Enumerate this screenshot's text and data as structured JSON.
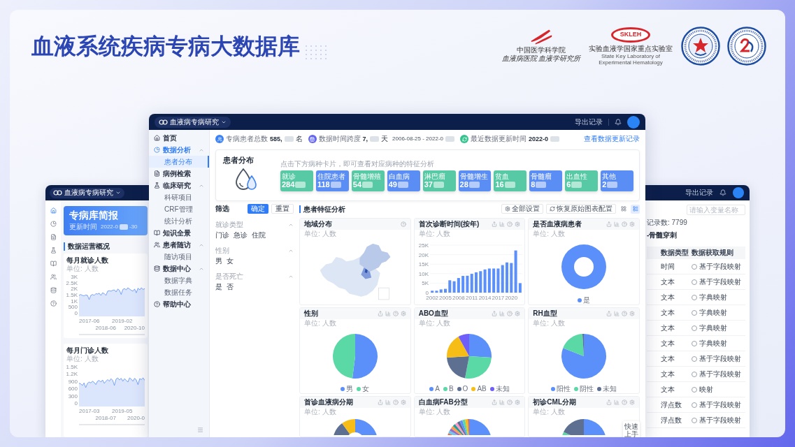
{
  "slide": {
    "title": "血液系统疾病专病大数据库"
  },
  "logos": {
    "institute_line_1": "中国医学科学院",
    "institute_line_2": "血液病医院 血液学研究所",
    "lab_badge": "SKLEH",
    "lab_name": "实验血液学国家重点实验室",
    "lab_name_en": "State Key Laboratory of Experimental Hematology"
  },
  "left_window": {
    "project": "血液病专病研究",
    "rail": [
      {
        "selected": true
      },
      {
        "selected": false
      },
      {
        "selected": false
      },
      {
        "selected": false
      },
      {
        "selected": false
      },
      {
        "selected": false
      },
      {
        "selected": false
      },
      {
        "selected": false
      }
    ],
    "banner": {
      "title": "专病库简报",
      "date_label": "更新时间",
      "date": "2022-0",
      "date_masked": true,
      "date_end": "-30"
    },
    "section_title": "数据运营概况",
    "charts": [
      {
        "title": "每月就诊人数",
        "unit": "单位: 人数",
        "y_labels": [
          "3K",
          "2.5K",
          "2K",
          "1.5K",
          "1K",
          "500",
          "0"
        ],
        "x_labels": [
          "2017-06",
          "2018-06",
          "2019-02",
          "2020-10"
        ]
      },
      {
        "title": "每月门诊人数",
        "unit": "单位: 人数",
        "y_labels": [
          "1.5K",
          "1.2K",
          "900",
          "600",
          "300",
          "0"
        ],
        "x_labels": [
          "2017-03",
          "2018-07",
          "2019-05",
          "2020-0"
        ]
      }
    ]
  },
  "main_window": {
    "project": "血液病专病研究",
    "header_link": "导出记录",
    "sidebar": [
      {
        "label": "首页",
        "selected": false
      },
      {
        "label": "数据分析",
        "selected": true,
        "expanded": true,
        "children": [
          {
            "label": "患者分布",
            "selected": true
          }
        ]
      },
      {
        "label": "病例检索",
        "selected": false
      },
      {
        "label": "临床研究",
        "selected": false,
        "expanded": true,
        "children": [
          {
            "label": "科研项目",
            "selected": false
          },
          {
            "label": "CRF管理",
            "selected": false
          },
          {
            "label": "统计分析",
            "selected": false
          }
        ]
      },
      {
        "label": "知识全景",
        "selected": false
      },
      {
        "label": "患者随访",
        "selected": false,
        "expanded": true,
        "children": [
          {
            "label": "随访项目",
            "selected": false
          }
        ]
      },
      {
        "label": "数据中心",
        "selected": false,
        "expanded": true,
        "children": [
          {
            "label": "数据字典",
            "selected": false
          },
          {
            "label": "数据任务",
            "selected": false
          }
        ]
      },
      {
        "label": "帮助中心",
        "selected": false
      }
    ],
    "stats": [
      {
        "label": "专病患者总数",
        "value": "585,",
        "masked": true,
        "unit": "名",
        "color": "#3b82f6"
      },
      {
        "label": "数据时间跨度",
        "value": "7,",
        "masked": true,
        "unit": "天",
        "range": "2006-08-25 - 2022-0",
        "range_masked": true,
        "color": "#6366f1"
      },
      {
        "label": "最近数据更新时间",
        "value": "2022-0",
        "masked": true,
        "color": "#34c38f"
      }
    ],
    "update_link": "查看数据更新记录",
    "distribution": {
      "title": "患者分布",
      "hint": "点击下方病种卡片，即可查看对应病种的特征分析",
      "cards": [
        {
          "label": "就诊",
          "value": "284",
          "masked": true,
          "color": "#57c9a4",
          "selected": false
        },
        {
          "label": "住院患者",
          "value": "118",
          "masked": true,
          "color": "#5b8ef5",
          "selected": false
        },
        {
          "label": "骨髓增殖",
          "value": "54",
          "masked": true,
          "color": "#57c9a4",
          "selected": false
        },
        {
          "label": "白血病",
          "value": "49",
          "masked": true,
          "color": "#5b8ef5",
          "selected": false
        },
        {
          "label": "淋巴瘤",
          "value": "37",
          "masked": true,
          "color": "#57c9a4",
          "selected": false
        },
        {
          "label": "骨髓增生",
          "value": "28",
          "masked": true,
          "color": "#5b8ef5",
          "selected": false
        },
        {
          "label": "贫血",
          "value": "16",
          "masked": true,
          "color": "#57c9a4",
          "selected": false
        },
        {
          "label": "骨髓瘤",
          "value": "8",
          "masked": true,
          "color": "#5b8ef5",
          "selected": false
        },
        {
          "label": "出血性",
          "value": "6",
          "masked": true,
          "color": "#57c9a4",
          "selected": false
        },
        {
          "label": "其他",
          "value": "2",
          "masked": true,
          "color": "#5b8ef5",
          "selected": false
        }
      ]
    },
    "filter": {
      "title": "筛选",
      "confirm": "确定",
      "reset": "重置",
      "groups": [
        {
          "label": "就诊类型",
          "expanded": true,
          "options": [
            {
              "label": "门诊",
              "selected": false
            },
            {
              "label": "急诊",
              "selected": false
            },
            {
              "label": "住院",
              "selected": false
            }
          ]
        },
        {
          "label": "性别",
          "expanded": true,
          "options": [
            {
              "label": "男",
              "selected": false
            },
            {
              "label": "女",
              "selected": false
            }
          ]
        },
        {
          "label": "是否死亡",
          "expanded": true,
          "options": [
            {
              "label": "是",
              "selected": false
            },
            {
              "label": "否",
              "selected": false
            }
          ]
        }
      ]
    },
    "analysis": {
      "title": "患者特征分析",
      "actions": [
        "全部设置",
        "恢复原始图表配置"
      ],
      "views": [
        {
          "kind": "grid",
          "selected": false
        },
        {
          "kind": "cards",
          "selected": true
        }
      ],
      "charts": [
        {
          "kind": "map",
          "title": "地域分布",
          "unit": "单位: 人数"
        },
        {
          "kind": "bar",
          "title": "首次诊断时间(按年)",
          "unit": "单位: 人数",
          "chart_data": {
            "type": "bar",
            "x": [
              2002,
              2003,
              2004,
              2005,
              2006,
              2007,
              2008,
              2009,
              2010,
              2011,
              2012,
              2013,
              2014,
              2015,
              2016,
              2017,
              2018,
              2019,
              2020,
              2021,
              2022
            ],
            "values": [
              1000,
              1000,
              1700,
              2000,
              6500,
              6000,
              7700,
              8800,
              8900,
              9900,
              10700,
              11300,
              12200,
              12700,
              12700,
              12700,
              14500,
              15900,
              15600,
              22200,
              5000
            ],
            "xlim": [
              2001.5,
              2022.5
            ],
            "xticks": [
              2002,
              2005,
              2008,
              2011,
              2014,
              2017,
              2020
            ],
            "ylim": [
              0,
              25000
            ],
            "yticks": [
              {
                "value": 0,
                "label": "0"
              },
              {
                "value": 5000,
                "label": "5K"
              },
              {
                "value": 10000,
                "label": "10K"
              },
              {
                "value": 15000,
                "label": "15K"
              },
              {
                "value": 20000,
                "label": "20K"
              },
              {
                "value": 25000,
                "label": "25K"
              }
            ],
            "grid": true
          }
        },
        {
          "kind": "donut",
          "title": "是否血液病患者",
          "unit": "单位: 人数",
          "legend": [
            {
              "label": "是",
              "color": "#5b8ff9"
            }
          ]
        },
        {
          "kind": "pie",
          "title": "性别",
          "unit": "单位: 人数",
          "legend": [
            {
              "label": "男",
              "color": "#5b8ff9"
            },
            {
              "label": "女",
              "color": "#5ad8a6"
            }
          ]
        },
        {
          "kind": "pie",
          "title": "ABO血型",
          "unit": "单位: 人数",
          "legend": [
            {
              "label": "A",
              "color": "#5b8ff9"
            },
            {
              "label": "B",
              "color": "#5ad8a6"
            },
            {
              "label": "O",
              "color": "#5d7092"
            },
            {
              "label": "AB",
              "color": "#f6bd16"
            },
            {
              "label": "未知",
              "color": "#6f5ef9"
            }
          ]
        },
        {
          "kind": "pie",
          "title": "RH血型",
          "unit": "单位: 人数",
          "legend": [
            {
              "label": "阳性",
              "color": "#5b8ff9"
            },
            {
              "label": "阴性",
              "color": "#5ad8a6"
            },
            {
              "label": "未知",
              "color": "#5d7092"
            }
          ]
        },
        {
          "kind": "donut",
          "title": "首诊血液病分期",
          "unit": "单位: 人数"
        },
        {
          "kind": "pie",
          "title": "白血病FAB分型",
          "unit": "单位: 人数"
        },
        {
          "kind": "pie",
          "title": "初诊CML分期",
          "unit": "单位: 人数"
        }
      ]
    },
    "quick_start": "快速上手"
  },
  "right_window": {
    "header_link": "导出记录",
    "search": {
      "placeholder": "请输入变量名称"
    },
    "record_count": "记录数: 7799",
    "category": "-骨髓穿刺",
    "columns": [
      "数据类型",
      "数据获取规则"
    ],
    "rows": [
      {
        "type": "时间",
        "rule": "基于字段映射",
        "selected": false
      },
      {
        "type": "文本",
        "rule": "基于字段映射",
        "selected": false
      },
      {
        "type": "文本",
        "rule": "字典映射",
        "selected": false
      },
      {
        "type": "文本",
        "rule": "字典映射",
        "selected": false
      },
      {
        "type": "文本",
        "rule": "字典映射",
        "selected": false
      },
      {
        "type": "文本",
        "rule": "字典映射",
        "selected": false
      },
      {
        "type": "文本",
        "rule": "基于字段映射",
        "selected": false
      },
      {
        "type": "文本",
        "rule": "基于字段映射",
        "selected": false
      },
      {
        "type": "文本",
        "rule": "映射",
        "selected": false
      },
      {
        "type": "浮点数",
        "rule": "基于字段映射",
        "selected": false
      },
      {
        "type": "浮点数",
        "rule": "基于字段映射",
        "selected": false
      }
    ]
  }
}
